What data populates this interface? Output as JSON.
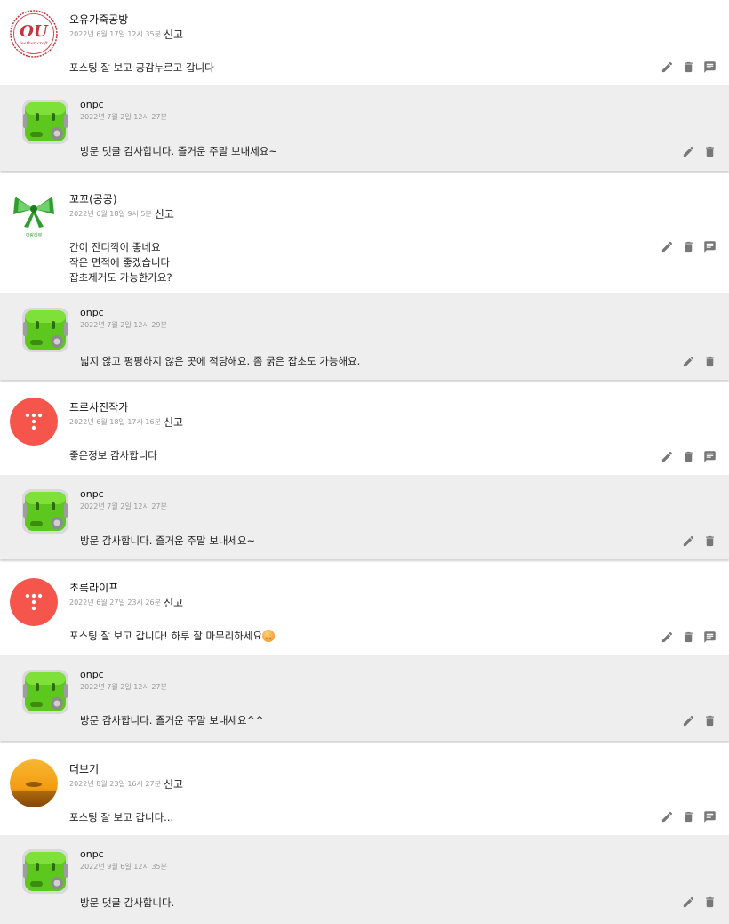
{
  "labels": {
    "report": "신고"
  },
  "threads": [
    {
      "comment": {
        "author": "오유가죽공방",
        "date": "2022년 6월 17일 12시 35분",
        "text": "포스팅 잘 보고 공감누르고 갑니다",
        "avatar_icon": "ou-leather-craft-logo-icon",
        "avatar_lettering": "OU leather craft"
      },
      "reply": {
        "author": "onpc",
        "date": "2022년 7월 2일 12시 27분",
        "text": "방문 댓글 감사합니다. 즐거운 주말 보내세요~"
      }
    },
    {
      "comment": {
        "author": "꼬꼬(공공)",
        "date": "2022년 6월 18일 9시 5분",
        "text": "간이 잔디깍이 좋네요\n작은 면적에 좋겠습니다\n잡초제거도 가능한가요?",
        "avatar_icon": "green-ribbon-icon",
        "avatar_lettering": "이랑리뷰"
      },
      "reply": {
        "author": "onpc",
        "date": "2022년 7월 2일 12시 29분",
        "text": "넓지 않고 평평하지 않은 곳에 적당해요. 좀 굵은 잡초도 가능해요."
      }
    },
    {
      "comment": {
        "author": "프로사진작가",
        "date": "2022년 6월 18일 17시 16분",
        "text": "좋은정보 감사합니다",
        "avatar_icon": "tistory-dots-icon"
      },
      "reply": {
        "author": "onpc",
        "date": "2022년 7월 2일 12시 27분",
        "text": "방문 감사합니다. 즐거운 주말 보내세요~"
      }
    },
    {
      "comment": {
        "author": "초록라이프",
        "date": "2022년 6월 27일 23시 26분",
        "text": "포스팅 잘 보고 갑니다! 하루 잘 마무리하세요",
        "avatar_icon": "tistory-dots-icon",
        "has_emoji": true
      },
      "reply": {
        "author": "onpc",
        "date": "2022년 7월 2일 12시 27분",
        "text": "방문 감사합니다. 즐거운 주말 보내세요^^"
      }
    },
    {
      "comment": {
        "author": "더보기",
        "date": "2022년 8월 23일 16시 27분",
        "text": "포스팅 잘 보고 갑니다...",
        "avatar_icon": "sunset-photo-icon"
      },
      "reply": {
        "author": "onpc",
        "date": "2022년 9월 6일 12시 35분",
        "text": "방문 댓글 감사합니다."
      }
    }
  ],
  "colors": {
    "reply_bg": "#eeeeee",
    "icon": "#777777",
    "tistory_red": "#f5554a",
    "onpc_green": "#5cc81e"
  }
}
